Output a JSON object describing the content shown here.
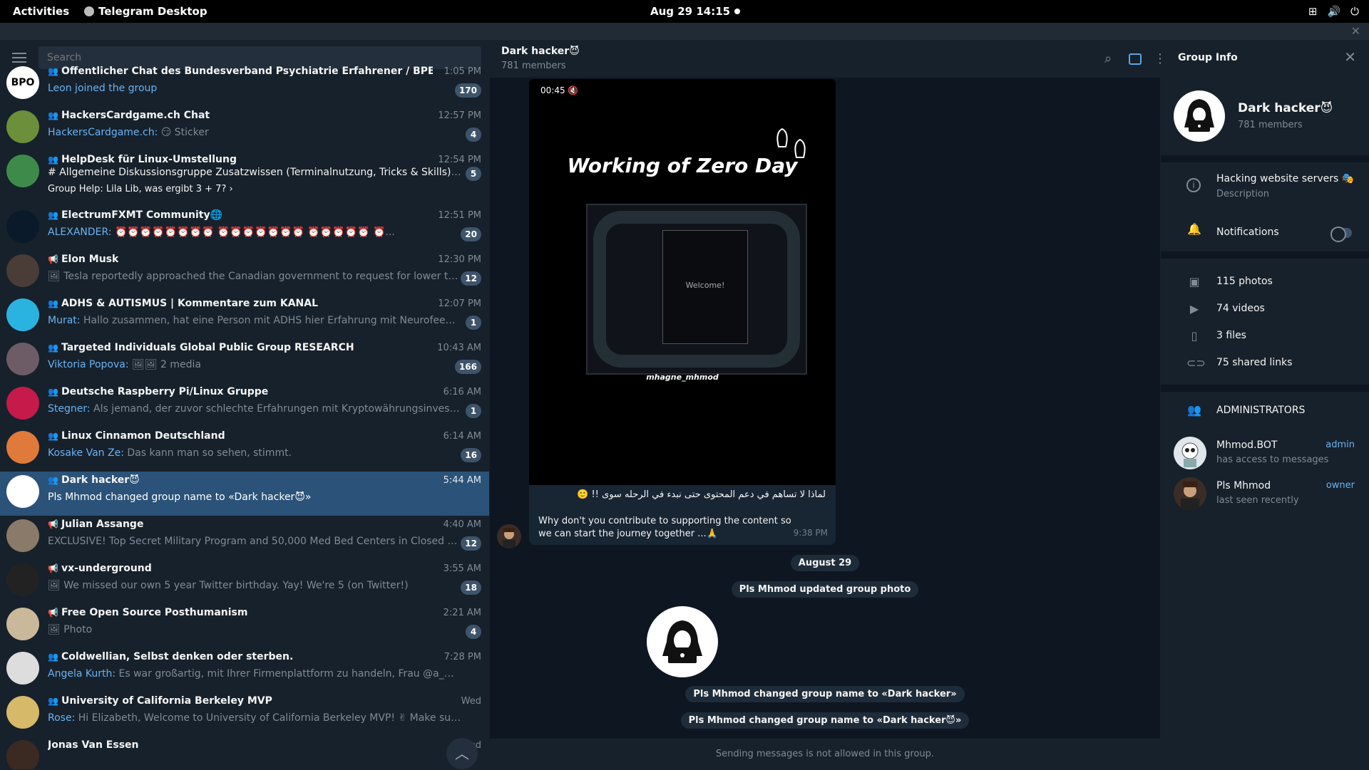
{
  "topbar": {
    "activities": "Activities",
    "app_name": "Telegram Desktop",
    "clock": "Aug 29  14:15"
  },
  "search": {
    "placeholder": "Search"
  },
  "chats": [
    {
      "title": "Offentlicher Chat des Bundesverband Psychiatrie Erfahrener / BPE_e.V.",
      "time": "1:05 PM",
      "who": "Leon joined the group",
      "text": "",
      "badge": "170",
      "kind": "group",
      "avatar_text": "BPO",
      "avatar_color": "#ffffff"
    },
    {
      "title": "HackersCardgame.ch Chat",
      "time": "12:57 PM",
      "who": "HackersCardgame.ch:",
      "text": "😏 Sticker",
      "badge": "4",
      "kind": "group",
      "avatar_text": "",
      "avatar_color": "#6b8f3a"
    },
    {
      "title": "HelpDesk für Linux-Umstellung",
      "time": "12:54 PM",
      "who": "",
      "text": "# Allgemeine Diskussionsgruppe   Zusatzwissen (Terminalnutzung, Tricks & Skills)  💬 Them...",
      "line3": "Group Help: Lila Lib, was ergibt 3 + 7?  ›",
      "badge": "5",
      "kind": "group",
      "avatar_text": "",
      "avatar_color": "#3e8a4b"
    },
    {
      "title": "ElectrumFXMT Community🌐",
      "time": "12:51 PM",
      "who": "ALEXANDER:",
      "text": "⏰⏰⏰⏰⏰⏰⏰⏰ ⏰⏰⏰⏰⏰⏰⏰ ⏰⏰⏰⏰⏰ ⏰...",
      "badge": "20",
      "kind": "group",
      "avatar_text": "",
      "avatar_color": "#0a1a2a"
    },
    {
      "title": "Elon Musk",
      "time": "12:30 PM",
      "who": "",
      "text": "🖼 Tesla reportedly approached the Canadian government to request for lower tariffs for its v...",
      "badge": "12",
      "kind": "channel",
      "avatar_text": "",
      "avatar_color": "#4a3c36"
    },
    {
      "title": "ADHS & AUTISMUS | Kommentare zum KANAL",
      "time": "12:07 PM",
      "who": "Murat:",
      "text": "Hallo zusammen, hat eine Person mit ADHS hier Erfahrung mit Neurofeedback?",
      "badge": "1",
      "kind": "group",
      "avatar_text": "",
      "avatar_color": "#2bb3e0"
    },
    {
      "title": "Targeted Individuals Global Public Group RESEARCH",
      "time": "10:43 AM",
      "who": "Viktoria Popova:",
      "text": "🖼🖼 2 media",
      "badge": "166",
      "kind": "group",
      "avatar_text": "",
      "avatar_color": "#6d5c66"
    },
    {
      "title": "Deutsche Raspberry Pi/Linux Gruppe",
      "time": "6:16 AM",
      "who": "Stegner:",
      "text": "Als jemand, der zuvor schlechte Erfahrungen mit Kryptowährungsinvestitionen gemac...",
      "badge": "1",
      "kind": "group",
      "avatar_text": "",
      "avatar_color": "#c51a4a"
    },
    {
      "title": "Linux Cinnamon Deutschland",
      "time": "6:14 AM",
      "who": "Kosake Van Ze:",
      "text": "Das kann man so sehen, stimmt.",
      "badge": "16",
      "kind": "group",
      "avatar_text": "",
      "avatar_color": "#e07a3a"
    },
    {
      "title": "Dark hacker😈",
      "time": "5:44 AM",
      "who": "",
      "text": "Pls Mhmod changed group name to «Dark hacker😈»",
      "badge": "",
      "kind": "group",
      "avatar_text": "",
      "avatar_color": "#ffffff",
      "selected": true
    },
    {
      "title": "Julian Assange",
      "time": "4:40 AM",
      "who": "",
      "text": "EXCLUSIVE! Top Secret Military Program and 50,000 Med Bed Centers in Closed Walmarts—Th...",
      "badge": "12",
      "kind": "channel",
      "avatar_text": "",
      "avatar_color": "#8a7a6a"
    },
    {
      "title": "vx-underground",
      "time": "3:55 AM",
      "who": "",
      "text": "🖼 We missed our own 5 year Twitter birthday.  Yay! We're 5 (on Twitter!)",
      "badge": "18",
      "kind": "channel",
      "avatar_text": "",
      "avatar_color": "#222222"
    },
    {
      "title": "Free Open Source Posthumanism",
      "time": "2:21 AM",
      "who": "",
      "text": "🖼 Photo",
      "badge": "4",
      "kind": "channel",
      "avatar_text": "",
      "avatar_color": "#c9b89a"
    },
    {
      "title": "Coldwellian, Selbst denken oder sterben.",
      "time": "7:28 PM",
      "who": "Angela Kurth:",
      "text": "Es war großartig, mit Ihrer Firmenplattform zu handeln, Frau @a_wirliebensteuern. ...",
      "badge": "",
      "kind": "group",
      "avatar_text": "",
      "avatar_color": "#dddddd"
    },
    {
      "title": "University of California Berkeley MVP",
      "time": "Wed",
      "who": "Rose:",
      "text": "Hi Elizabeth, Welcome to University of California Berkeley MVP! ✌  Make sure to complete t...",
      "badge": "",
      "kind": "group",
      "avatar_text": "",
      "avatar_color": "#d7b96a"
    },
    {
      "title": "Jonas Van Essen",
      "time": "Wed",
      "who": "",
      "text": "",
      "badge": "",
      "kind": "user",
      "avatar_text": "",
      "avatar_color": "#3b2a22"
    }
  ],
  "chat": {
    "title": "Dark hacker😈",
    "members": "781 members",
    "video_duration": "00:45",
    "video_title": "Working of Zero Day",
    "video_welcome": "Welcome!",
    "video_handle": "mhagne_mhmod",
    "message_ar": "لماذا لا تساهم في دعم المحتوى حتى نبدء في الرحله سوى !! 🙂",
    "message_en": "Why don't you contribute to supporting the content so we can start the journey together ...🙏",
    "message_time": "9:38 PM",
    "date_sep": "August 29",
    "svc1": "Pls Mhmod updated group photo",
    "svc2": "Pls Mhmod changed group name to «Dark hacker»",
    "svc3": "Pls Mhmod changed group name to «Dark hacker😈»",
    "not_allowed": "Sending messages is not allowed in this group."
  },
  "info": {
    "header": "Group Info",
    "name": "Dark hacker😈",
    "members": "781 members",
    "description": "Hacking website servers 🎭",
    "description_label": "Description",
    "notifications": "Notifications",
    "photos": "115 photos",
    "videos": "74 videos",
    "files": "3 files",
    "links": "75 shared links",
    "admins_header": "ADMINISTRATORS",
    "admins": [
      {
        "name": "Mhmod.BOT",
        "status": "has access to messages",
        "role": "admin"
      },
      {
        "name": "Pls Mhmod",
        "status": "last seen recently",
        "role": "owner"
      }
    ]
  }
}
